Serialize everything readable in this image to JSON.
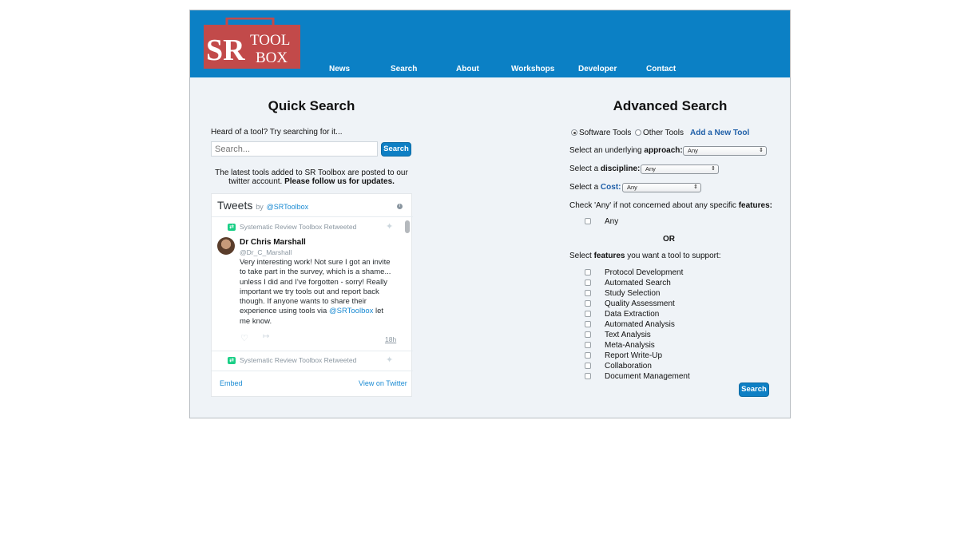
{
  "nav": [
    "News",
    "Search",
    "About",
    "Workshops",
    "Developer",
    "Contact"
  ],
  "logo": {
    "sr": "SR",
    "tool": "TOOL",
    "box": "BOX"
  },
  "quick_search": {
    "title": "Quick Search",
    "prompt": "Heard of a tool? Try searching for it...",
    "placeholder": "Search...",
    "button": "Search",
    "notice_line1": "The latest tools added to SR Toolbox are posted to our",
    "notice_line2_a": "twitter account. ",
    "notice_line2_b": "Please follow us for updates."
  },
  "twitter": {
    "heading": "Tweets",
    "by": "by",
    "handle": "@SRToolbox",
    "retweet_label": "Systematic Review Toolbox Retweeted",
    "author": "Dr Chris Marshall",
    "author_handle": "@Dr_C_Marshall",
    "tweet_lines": [
      "Very interesting work! Not sure I got an invite",
      "to take part in the survey, which is a shame...",
      "unless I did and I've forgotten - sorry! Really",
      "important we try tools out and report back",
      "though. If anyone wants to share their"
    ],
    "tweet_line6_a": "experience using tools via ",
    "tweet_line6_link": "@SRToolbox",
    "tweet_line6_b": " let",
    "tweet_line7": "me know.",
    "time": "18h",
    "retweet_label_2": "Systematic Review Toolbox Retweeted",
    "embed": "Embed",
    "view_on_twitter": "View on Twitter"
  },
  "advanced_search": {
    "title": "Advanced Search",
    "radio_software": "Software Tools",
    "radio_other": "Other Tools",
    "add_tool": "Add a New Tool",
    "approach_label_a": "Select an underlying ",
    "approach_label_b": "approach:",
    "approach_value": "Any",
    "discipline_label_a": "Select a ",
    "discipline_label_b": "discipline:",
    "discipline_value": "Any",
    "cost_label_a": "Select a ",
    "cost_label_b": "Cost:",
    "cost_value": "Any",
    "any_note_a": "Check 'Any' if not concerned about any specific ",
    "any_note_b": "features:",
    "any_label": "Any",
    "or": "OR",
    "features_note_a": "Select ",
    "features_note_b": "features",
    "features_note_c": " you want a tool to support:",
    "features": [
      "Protocol Development",
      "Automated Search",
      "Study Selection",
      "Quality Assessment",
      "Data Extraction",
      "Automated Analysis",
      "Text Analysis",
      "Meta-Analysis",
      "Report Write-Up",
      "Collaboration",
      "Document Management"
    ],
    "button": "Search"
  },
  "colors": {
    "header": "#0b80c5",
    "link": "#1f5fa8",
    "button": "#0e7fc4",
    "logo": "#c24a4a"
  }
}
